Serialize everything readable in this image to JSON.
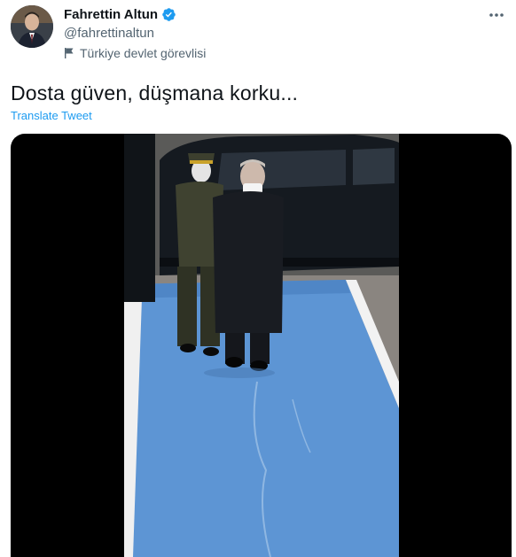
{
  "user": {
    "display_name": "Fahrettin Altun",
    "handle": "@fahrettinaltun",
    "label": "Türkiye devlet görevlisi",
    "avatar_icon": "profile-photo",
    "verified_icon": "verified-badge-icon",
    "verified_color": "#1d9bf0"
  },
  "tweet": {
    "text": "Dosta güven, düşmana korku...",
    "translate_label": "Translate Tweet",
    "link_color": "#1d9bf0"
  },
  "media": {
    "type": "video",
    "path_color": "#6fa0d8",
    "background": "#000000"
  },
  "more_icon": "more-options-icon"
}
